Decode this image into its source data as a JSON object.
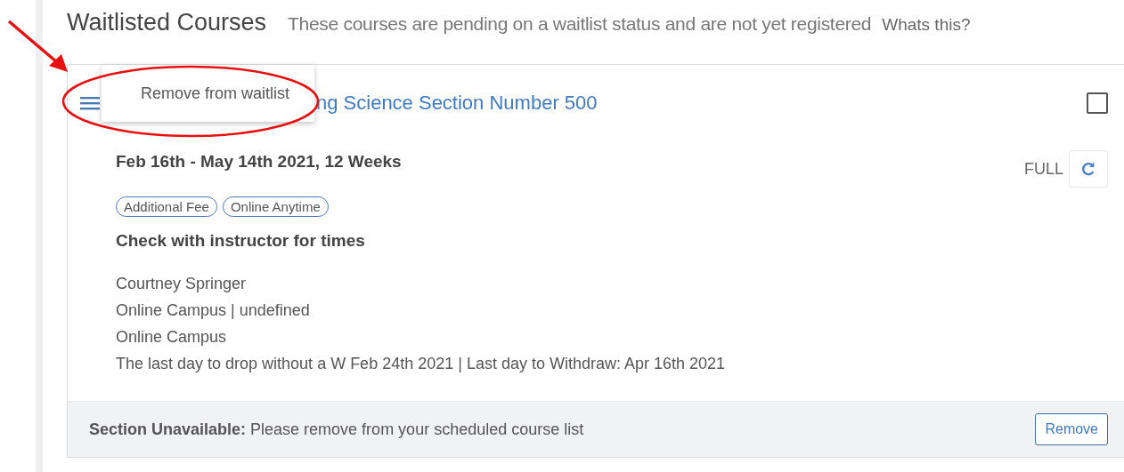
{
  "header": {
    "title": "Waitlisted Courses",
    "description": "These courses are pending on a waitlist status and are not yet registered",
    "help_link": "Whats this?"
  },
  "course": {
    "menu": {
      "expanded": true,
      "items": [
        "Remove from waitlist"
      ]
    },
    "title": "ng Science Section Number 500",
    "checked": false,
    "dates": "Feb 16th - May 14th 2021, 12 Weeks",
    "status": "FULL",
    "tags": [
      "Additional Fee",
      "Online Anytime"
    ],
    "schedule": "Check with instructor for times",
    "details": [
      "Courtney Springer",
      "Online Campus | undefined",
      "Online Campus",
      "The last day to drop without a W Feb 24th 2021 | Last day to Withdraw: Apr 16th 2021"
    ],
    "notice": {
      "label": "Section Unavailable:",
      "message": "Please remove from your scheduled course list"
    },
    "action": "Remove"
  },
  "annotations": {
    "arrow": true,
    "ellipse": true
  }
}
